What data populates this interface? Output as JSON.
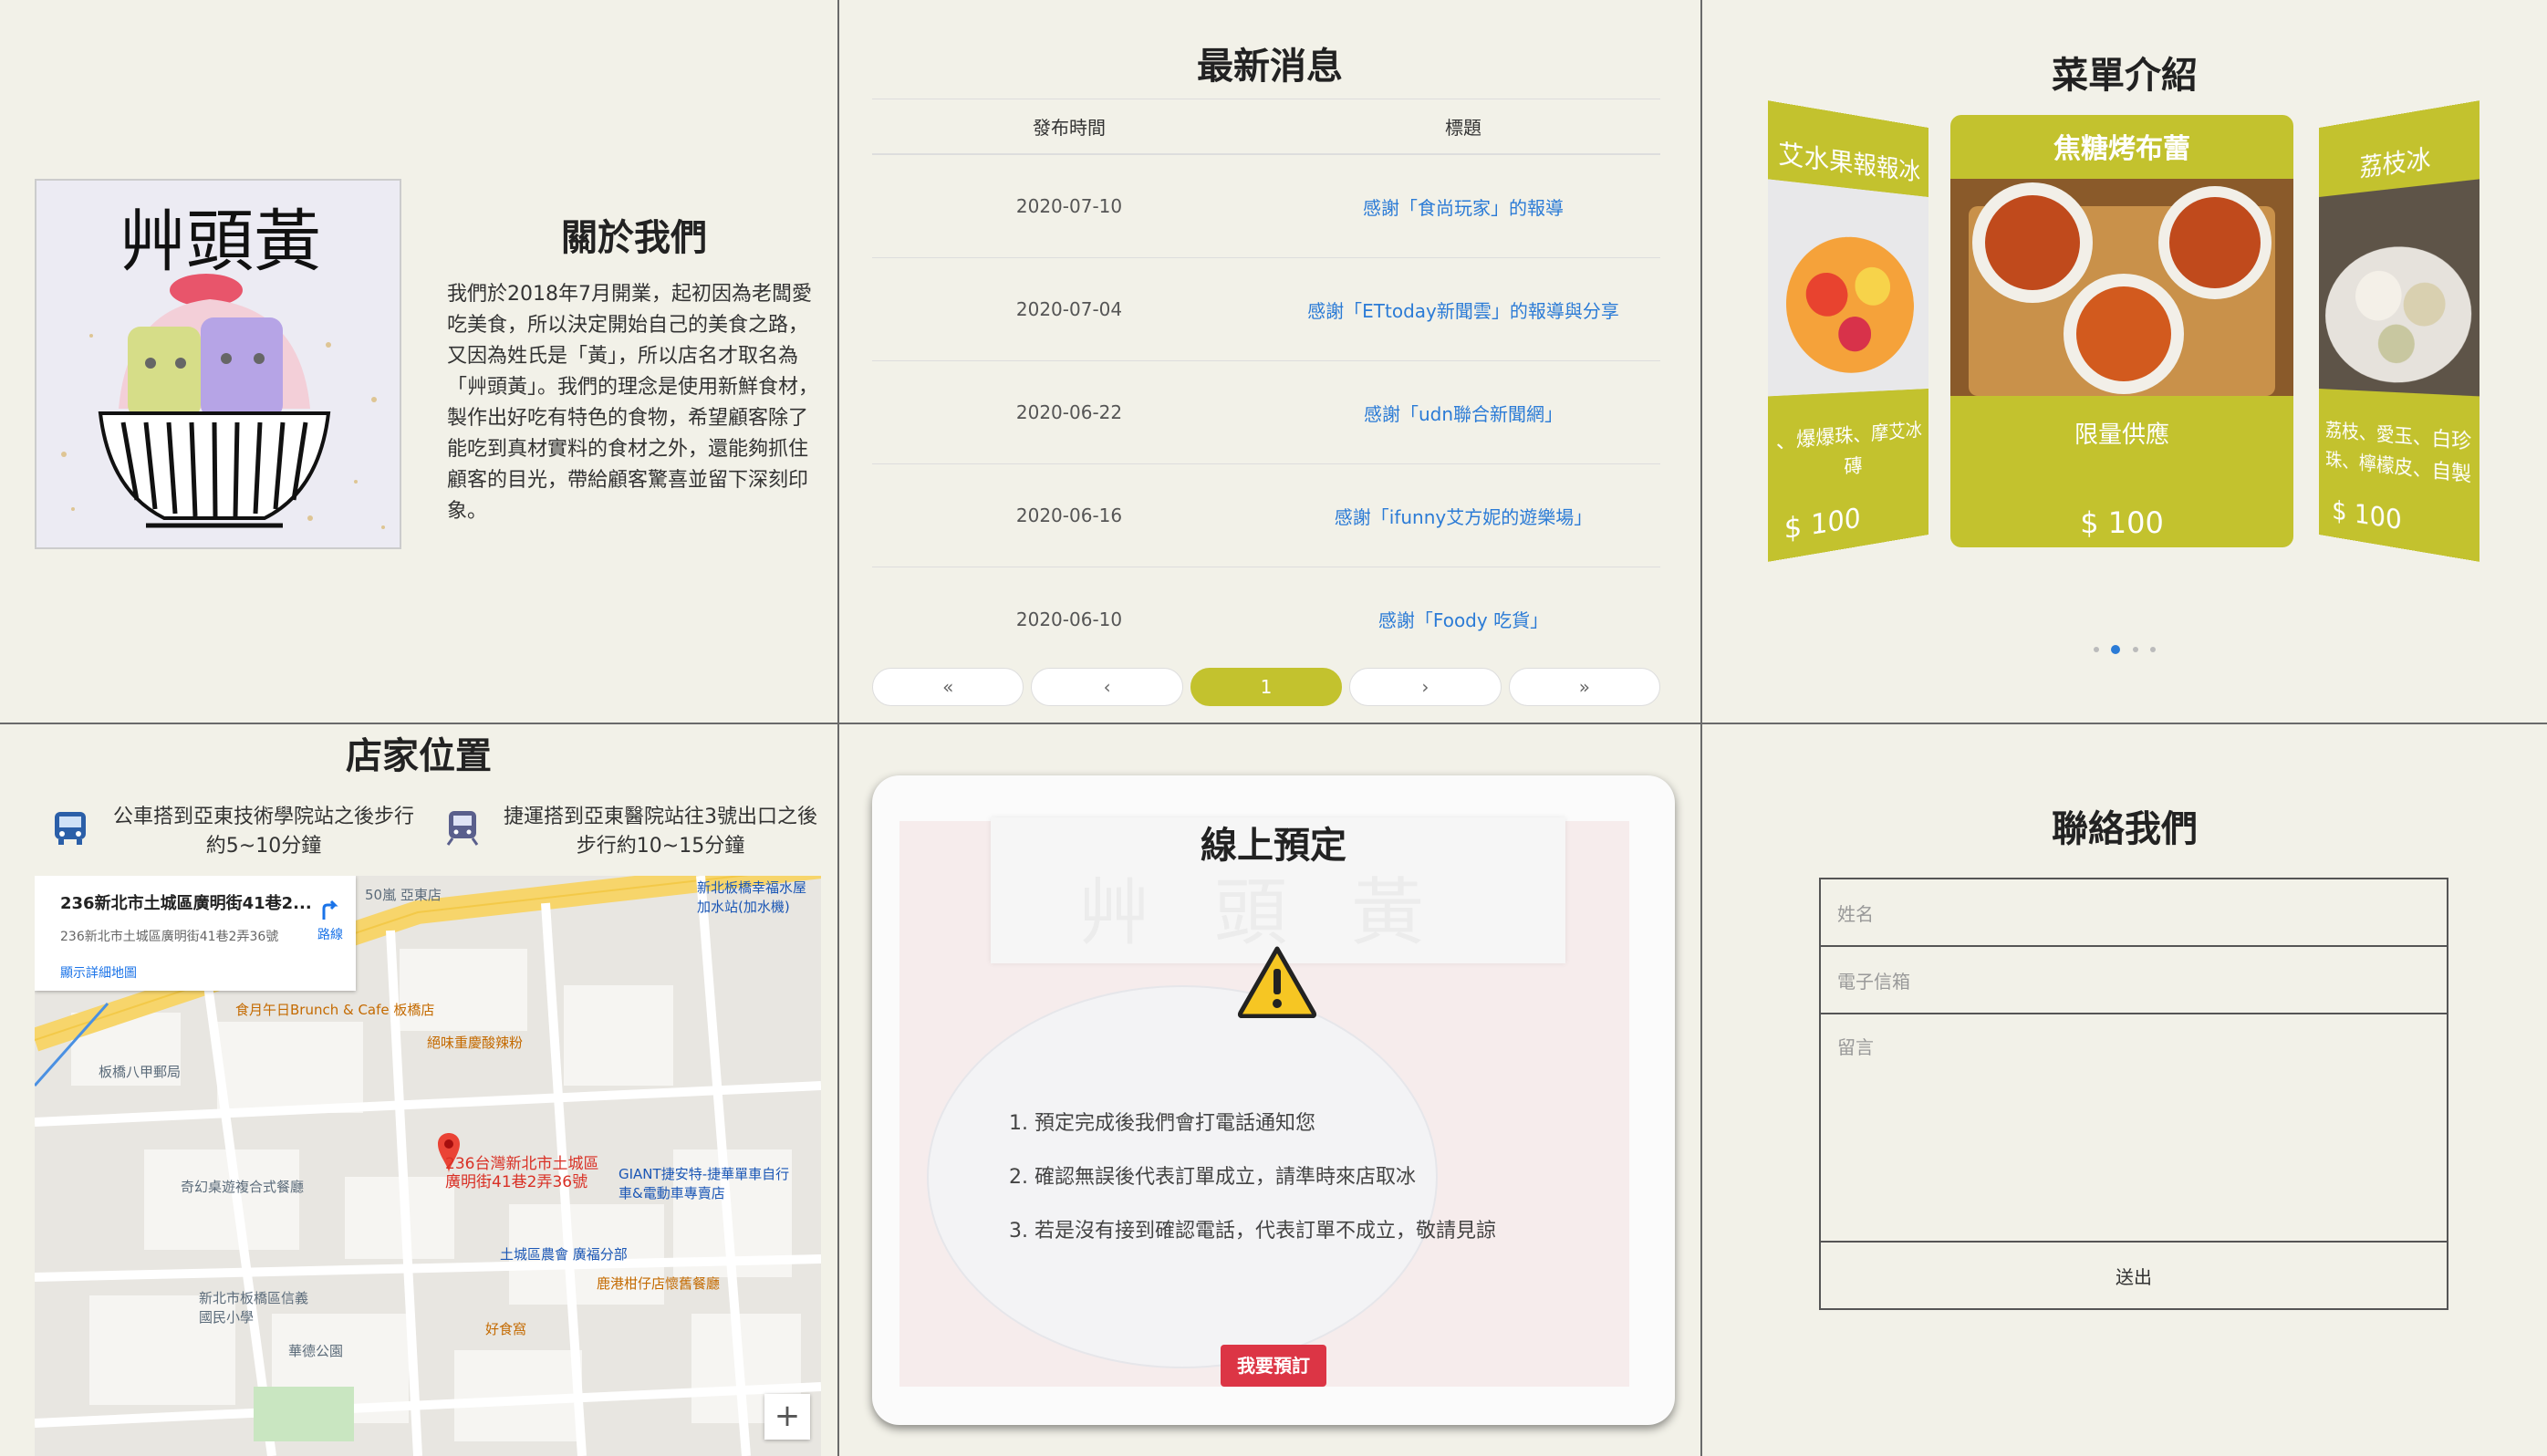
{
  "about": {
    "title": "關於我們",
    "logo_text": "艸頭黃",
    "text": "我們於2018年7月開業，起初因為老闆愛吃美食，所以決定開始自己的美食之路，又因為姓氏是「黃」，所以店名才取名為「艸頭黃」。我們的理念是使用新鮮食材，製作出好吃有特色的食物，希望顧客除了能吃到真材實料的食材之外，還能夠抓住顧客的目光，帶給顧客驚喜並留下深刻印象。"
  },
  "news": {
    "title": "最新消息",
    "col_date": "發布時間",
    "col_title": "標題",
    "rows": [
      {
        "date": "2020-07-10",
        "title": "感謝「食尚玩家」的報導"
      },
      {
        "date": "2020-07-04",
        "title": "感謝「ETtoday新聞雲」的報導與分享"
      },
      {
        "date": "2020-06-22",
        "title": "感謝「udn聯合新聞網」"
      },
      {
        "date": "2020-06-16",
        "title": "感謝「ifunny艾方妮的遊樂場」"
      },
      {
        "date": "2020-06-10",
        "title": "感謝「Foody 吃貨」"
      }
    ],
    "pager": {
      "first": "«",
      "prev": "‹",
      "current": "1",
      "next": "›",
      "last": "»"
    }
  },
  "menu": {
    "title": "菜單介紹",
    "left_card": {
      "name": "艾水果報報冰",
      "desc": "、爆爆珠、摩艾冰磚",
      "price": "$ 100"
    },
    "main_card": {
      "name": "焦糖烤布蕾",
      "desc": "限量供應",
      "price": "$ 100"
    },
    "right_card": {
      "name": "荔枝冰",
      "desc": "荔枝、愛玉、白珍珠、檸檬皮、自製",
      "price": "$ 100"
    },
    "active_dot": 1,
    "dot_count": 4
  },
  "location": {
    "title": "店家位置",
    "bus_text": "公車搭到亞東技術學院站之後步行約5~10分鐘",
    "mrt_text": "捷運搭到亞東醫院站往3號出口之後步行約10~15分鐘",
    "map": {
      "card_title": "236新北市土城區廣明街41巷2...",
      "card_addr": "236新北市土城區廣明街41巷2弄36號",
      "card_link": "顯示詳細地圖",
      "route_label": "路線",
      "pin_label": "236台灣新北市土城區廣明街41巷2弄36號",
      "zoom_in": "+",
      "labels": [
        {
          "text": "食月午日Brunch & Cafe 板橋店",
          "kind": "o"
        },
        {
          "text": "絕味重慶酸辣粉",
          "kind": "o"
        },
        {
          "text": "板橋八甲郵局",
          "kind": "g"
        },
        {
          "text": "奇幻桌遊複合式餐廳",
          "kind": "g"
        },
        {
          "text": "GIANT捷安特-捷華單車自行車&電動車專賣店",
          "kind": "b"
        },
        {
          "text": "土城區農會 廣福分部",
          "kind": "b"
        },
        {
          "text": "鹿港柑仔店懷舊餐廳",
          "kind": "o"
        },
        {
          "text": "好食窩",
          "kind": "o"
        },
        {
          "text": "新北市板橋區信義國民小學",
          "kind": "g"
        },
        {
          "text": "華德公園",
          "kind": "g"
        },
        {
          "text": "新北板橋幸福水屋加水站(加水機)",
          "kind": "b"
        },
        {
          "text": "50嵐 亞東店",
          "kind": "g"
        }
      ]
    }
  },
  "booking": {
    "title": "線上預定",
    "watermark": "艸頭黃",
    "items": [
      "1. 預定完成後我們會打電話通知您",
      "2. 確認無誤後代表訂單成立，請準時來店取冰",
      "3. 若是沒有接到確認電話，代表訂單不成立，敬請見諒"
    ],
    "button": "我要預訂"
  },
  "contact": {
    "title": "聯絡我們",
    "name_placeholder": "姓名",
    "email_placeholder": "電子信箱",
    "message_placeholder": "留言",
    "submit": "送出"
  },
  "colors": {
    "accent": "#c3c22e",
    "link": "#2b7bd6",
    "danger": "#dc3545",
    "background": "#f2f1e8"
  }
}
